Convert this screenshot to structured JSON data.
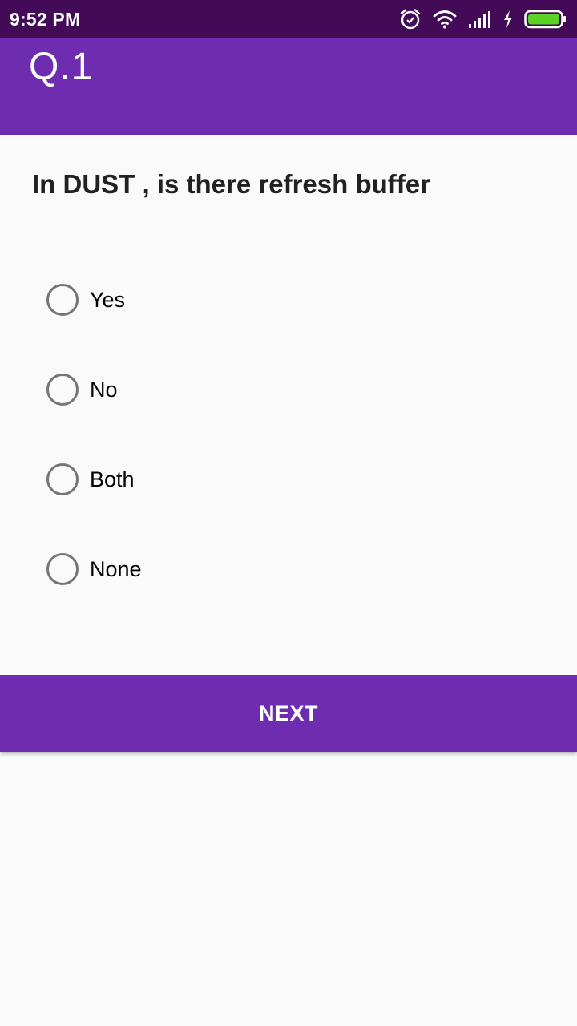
{
  "status_bar": {
    "time": "9:52 PM",
    "icons": [
      "alarm-icon",
      "wifi-icon",
      "signal-icon",
      "charging-icon",
      "battery-icon"
    ],
    "colors": {
      "background": "#430B57",
      "battery_fill": "#5CD323"
    }
  },
  "app_bar": {
    "title": "Q.1",
    "color": "#6E2DB0"
  },
  "question": {
    "text": "In DUST , is there refresh buffer"
  },
  "options": [
    {
      "label": "Yes",
      "selected": false
    },
    {
      "label": "No",
      "selected": false
    },
    {
      "label": "Both",
      "selected": false
    },
    {
      "label": "None",
      "selected": false
    }
  ],
  "next_button": {
    "label": "NEXT",
    "color": "#6E2DB0"
  }
}
